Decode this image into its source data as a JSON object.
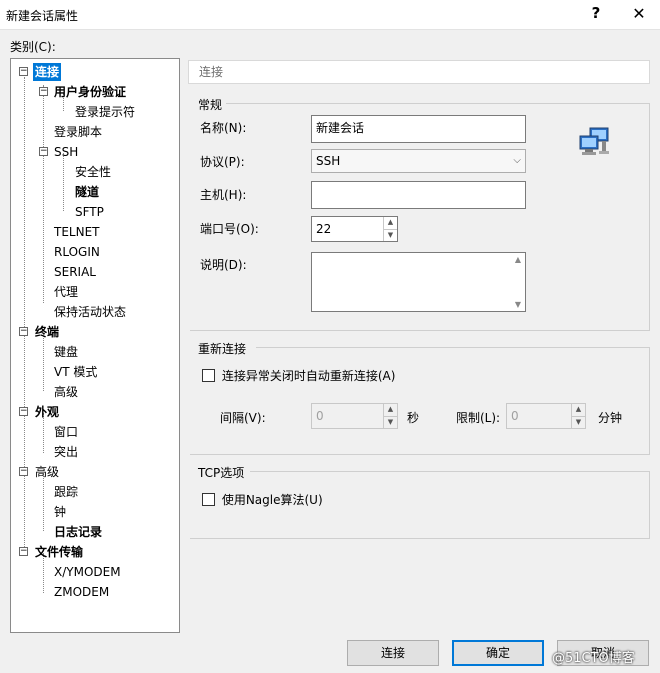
{
  "window": {
    "title": "新建会话属性",
    "help": "?",
    "close": "✕"
  },
  "category_label": "类别(C):",
  "tree": [
    {
      "label": "连接",
      "bold": true,
      "selected": true
    },
    {
      "label": "用户身份验证",
      "bold": true
    },
    {
      "label": "登录提示符"
    },
    {
      "label": "登录脚本"
    },
    {
      "label": "SSH"
    },
    {
      "label": "安全性"
    },
    {
      "label": "隧道",
      "bold": true
    },
    {
      "label": "SFTP"
    },
    {
      "label": "TELNET"
    },
    {
      "label": "RLOGIN"
    },
    {
      "label": "SERIAL"
    },
    {
      "label": "代理"
    },
    {
      "label": "保持活动状态"
    },
    {
      "label": "终端",
      "bold": true
    },
    {
      "label": "键盘"
    },
    {
      "label": "VT 模式"
    },
    {
      "label": "高级"
    },
    {
      "label": "外观",
      "bold": true
    },
    {
      "label": "窗口"
    },
    {
      "label": "突出"
    },
    {
      "label": "高级"
    },
    {
      "label": "跟踪"
    },
    {
      "label": "钟"
    },
    {
      "label": "日志记录",
      "bold": true
    },
    {
      "label": "文件传输",
      "bold": true
    },
    {
      "label": "X/YMODEM"
    },
    {
      "label": "ZMODEM"
    }
  ],
  "breadcrumb": "连接",
  "general": {
    "title": "常规",
    "name_label": "名称(N):",
    "name_value": "新建会话",
    "protocol_label": "协议(P):",
    "protocol_value": "SSH",
    "host_label": "主机(H):",
    "host_value": "",
    "port_label": "端口号(O):",
    "port_value": "22",
    "desc_label": "说明(D):",
    "desc_value": ""
  },
  "reconnect": {
    "title": "重新连接",
    "auto_label": "连接异常关闭时自动重新连接(A)",
    "interval_label": "间隔(V):",
    "interval_value": "0",
    "interval_unit": "秒",
    "limit_label": "限制(L):",
    "limit_value": "0",
    "limit_unit": "分钟"
  },
  "tcp": {
    "title": "TCP选项",
    "nagle_label": "使用Nagle算法(U)"
  },
  "buttons": {
    "connect": "连接",
    "ok": "确定",
    "cancel": "取消"
  },
  "watermark": "@51CTO博客",
  "colors": {
    "selection": "#0078d7"
  }
}
